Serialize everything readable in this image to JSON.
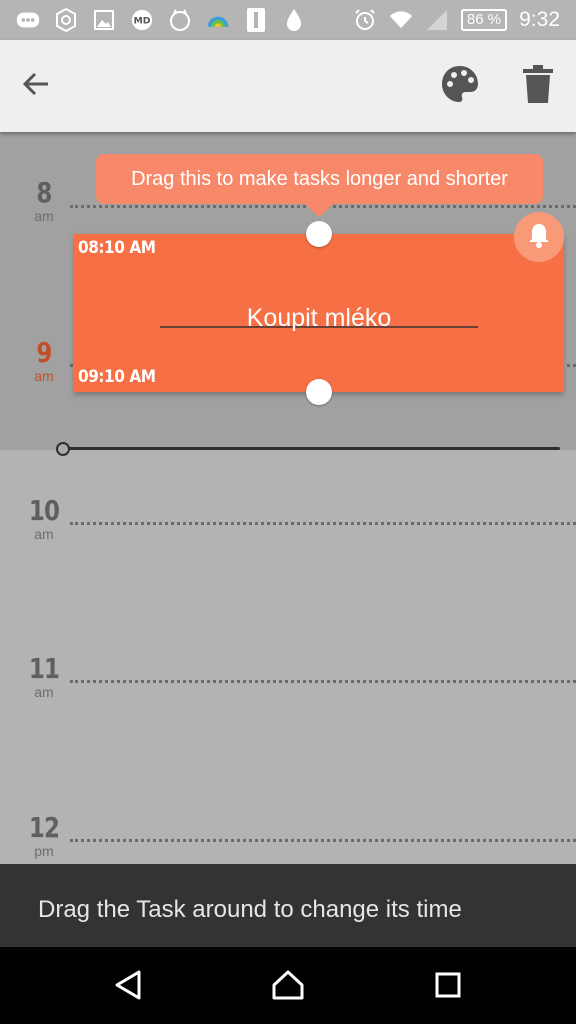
{
  "status_bar": {
    "icons": [
      "notification-icon",
      "settings-cog-icon",
      "image-icon",
      "md-app-icon",
      "android-cat-icon",
      "rainbow-app-icon",
      "sim-card-icon",
      "water-drop-icon"
    ],
    "right_icons": [
      "alarm-icon",
      "wifi-icon",
      "signal-icon"
    ],
    "battery": "86 %",
    "time": "9:32"
  },
  "toolbar": {
    "back_icon": "arrow-back-icon",
    "palette_icon": "palette-icon",
    "delete_icon": "trash-icon"
  },
  "hours": [
    {
      "num": "8",
      "ampm": "am"
    },
    {
      "num": "9",
      "ampm": "am"
    },
    {
      "num": "10",
      "ampm": "am"
    },
    {
      "num": "11",
      "ampm": "am"
    },
    {
      "num": "12",
      "ampm": "pm"
    }
  ],
  "task": {
    "start": "08:10 AM",
    "end": "09:10 AM",
    "title": "Koupit mléko",
    "bell_icon": "bell-icon"
  },
  "tooltip": "Drag this to make tasks longer and shorter",
  "snackbar": "Drag the Task around to change its time",
  "colors": {
    "accent": "#f66f45",
    "tooltip": "#f7896a",
    "current_hour": "#c0502b",
    "snackbar": "#333333"
  },
  "nav": {
    "back": "nav-back-icon",
    "home": "nav-home-icon",
    "recents": "nav-recents-icon"
  }
}
